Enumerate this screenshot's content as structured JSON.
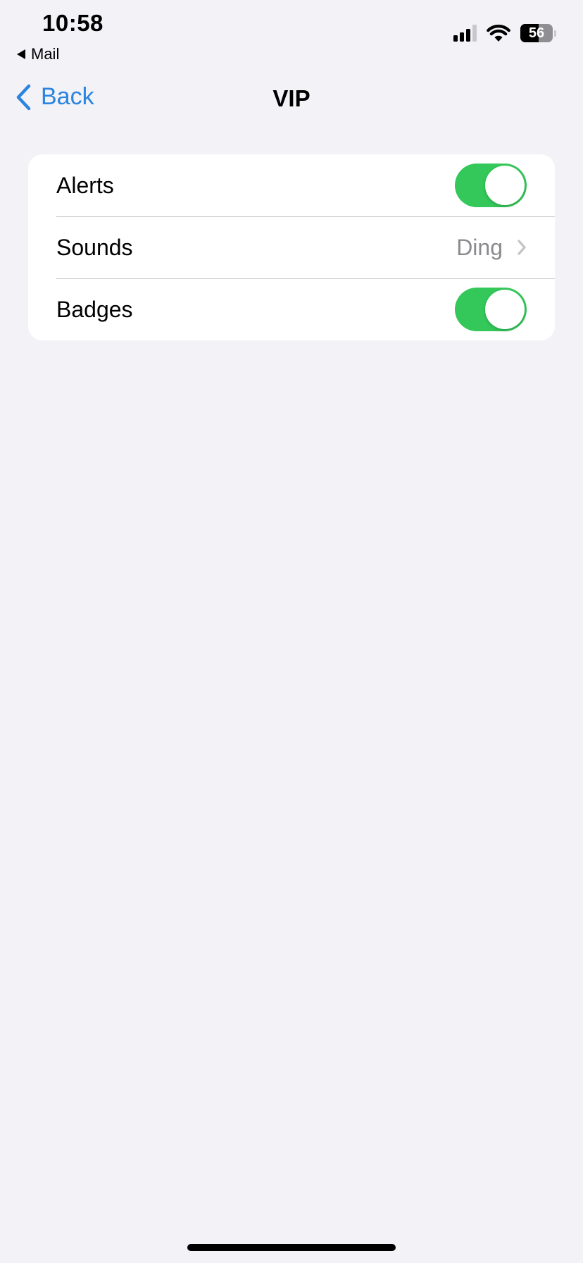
{
  "status_bar": {
    "time": "10:58",
    "back_app": "Mail",
    "battery_level": "56",
    "battery_fraction": 0.56,
    "signal_bars_active": 3,
    "signal_bars_total": 4
  },
  "nav": {
    "back_label": "Back",
    "title": "VIP"
  },
  "settings": {
    "alerts": {
      "label": "Alerts",
      "on": true
    },
    "sounds": {
      "label": "Sounds",
      "value": "Ding"
    },
    "badges": {
      "label": "Badges",
      "on": true
    }
  },
  "colors": {
    "accent": "#2b84e0",
    "toggle_on": "#34c759",
    "background": "#f2f2f7"
  },
  "icons": {
    "back": "chevron-left-icon",
    "sounds_disclosure": "chevron-right-icon",
    "status_back": "back-triangle-icon",
    "signal": "cellular-signal-icon",
    "wifi": "wifi-icon",
    "battery": "battery-icon"
  }
}
